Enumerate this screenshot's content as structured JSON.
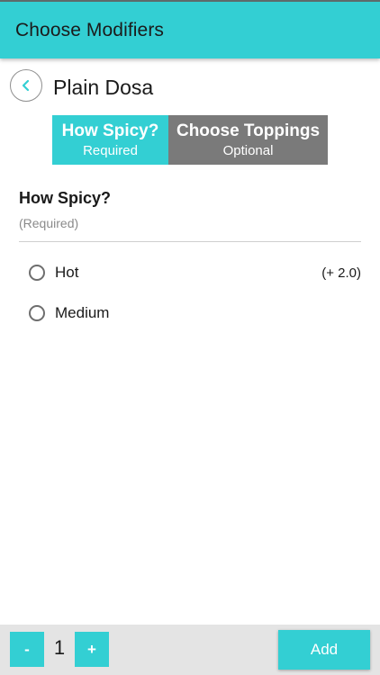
{
  "app_bar": {
    "title": "Choose Modifiers"
  },
  "header": {
    "back_icon": "chevron-left-icon",
    "product_name": "Plain Dosa"
  },
  "tabs": [
    {
      "title": "How Spicy?",
      "subtitle": "Required",
      "active": true
    },
    {
      "title": "Choose Toppings",
      "subtitle": "Optional",
      "active": false
    }
  ],
  "section": {
    "title": "How Spicy?",
    "subtitle": "(Required)",
    "options": [
      {
        "label": "Hot",
        "price": "(+ 2.0)",
        "selected": false
      },
      {
        "label": "Medium",
        "price": "",
        "selected": false
      }
    ]
  },
  "footer": {
    "decrement_label": "-",
    "quantity": "1",
    "increment_label": "+",
    "add_label": "Add"
  },
  "colors": {
    "accent": "#33cfd3",
    "inactive_tab": "#7a7a7a",
    "footer_bg": "#e4e4e4"
  }
}
